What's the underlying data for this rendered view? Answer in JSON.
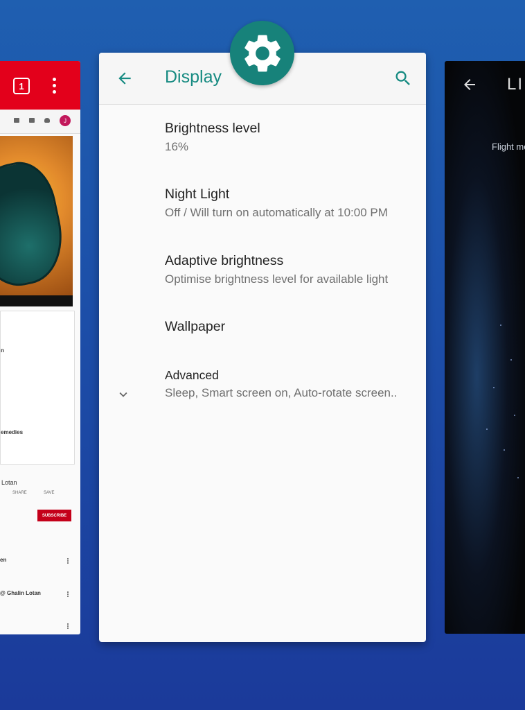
{
  "left_app": {
    "tab_count": "1",
    "avatar_letter": "J",
    "list_texts": [
      "n",
      "emedies"
    ],
    "channel_line": "Lotan",
    "share_label": "SHARE",
    "save_label": "SAVE",
    "subscribe_label": "SUBSCRIBE",
    "up_next": [
      "en",
      "@ Ghalin Lotan"
    ]
  },
  "settings": {
    "title": "Display",
    "items": [
      {
        "label": "Brightness level",
        "summary": "16%"
      },
      {
        "label": "Night Light",
        "summary": "Off / Will turn on automatically at 10:00 PM"
      },
      {
        "label": "Adaptive brightness",
        "summary": "Optimise brightness level for available light"
      },
      {
        "label": "Wallpaper",
        "summary": ""
      },
      {
        "label": "Advanced",
        "summary": "Sleep, Smart screen on, Auto-rotate screen.."
      }
    ],
    "icons": {
      "back": "arrow-left-icon",
      "search": "search-icon",
      "expand": "chevron-down-icon",
      "app": "gear-icon"
    },
    "colors": {
      "accent": "#178b82",
      "app_icon_bg": "#17827a"
    }
  },
  "right_app": {
    "title_partial": "LI",
    "flight_mode_partial": "Flight mo"
  },
  "colors": {
    "background_top": "#1f5fb0",
    "background_bottom": "#1b3a9a",
    "youtube_red": "#e3001b"
  }
}
